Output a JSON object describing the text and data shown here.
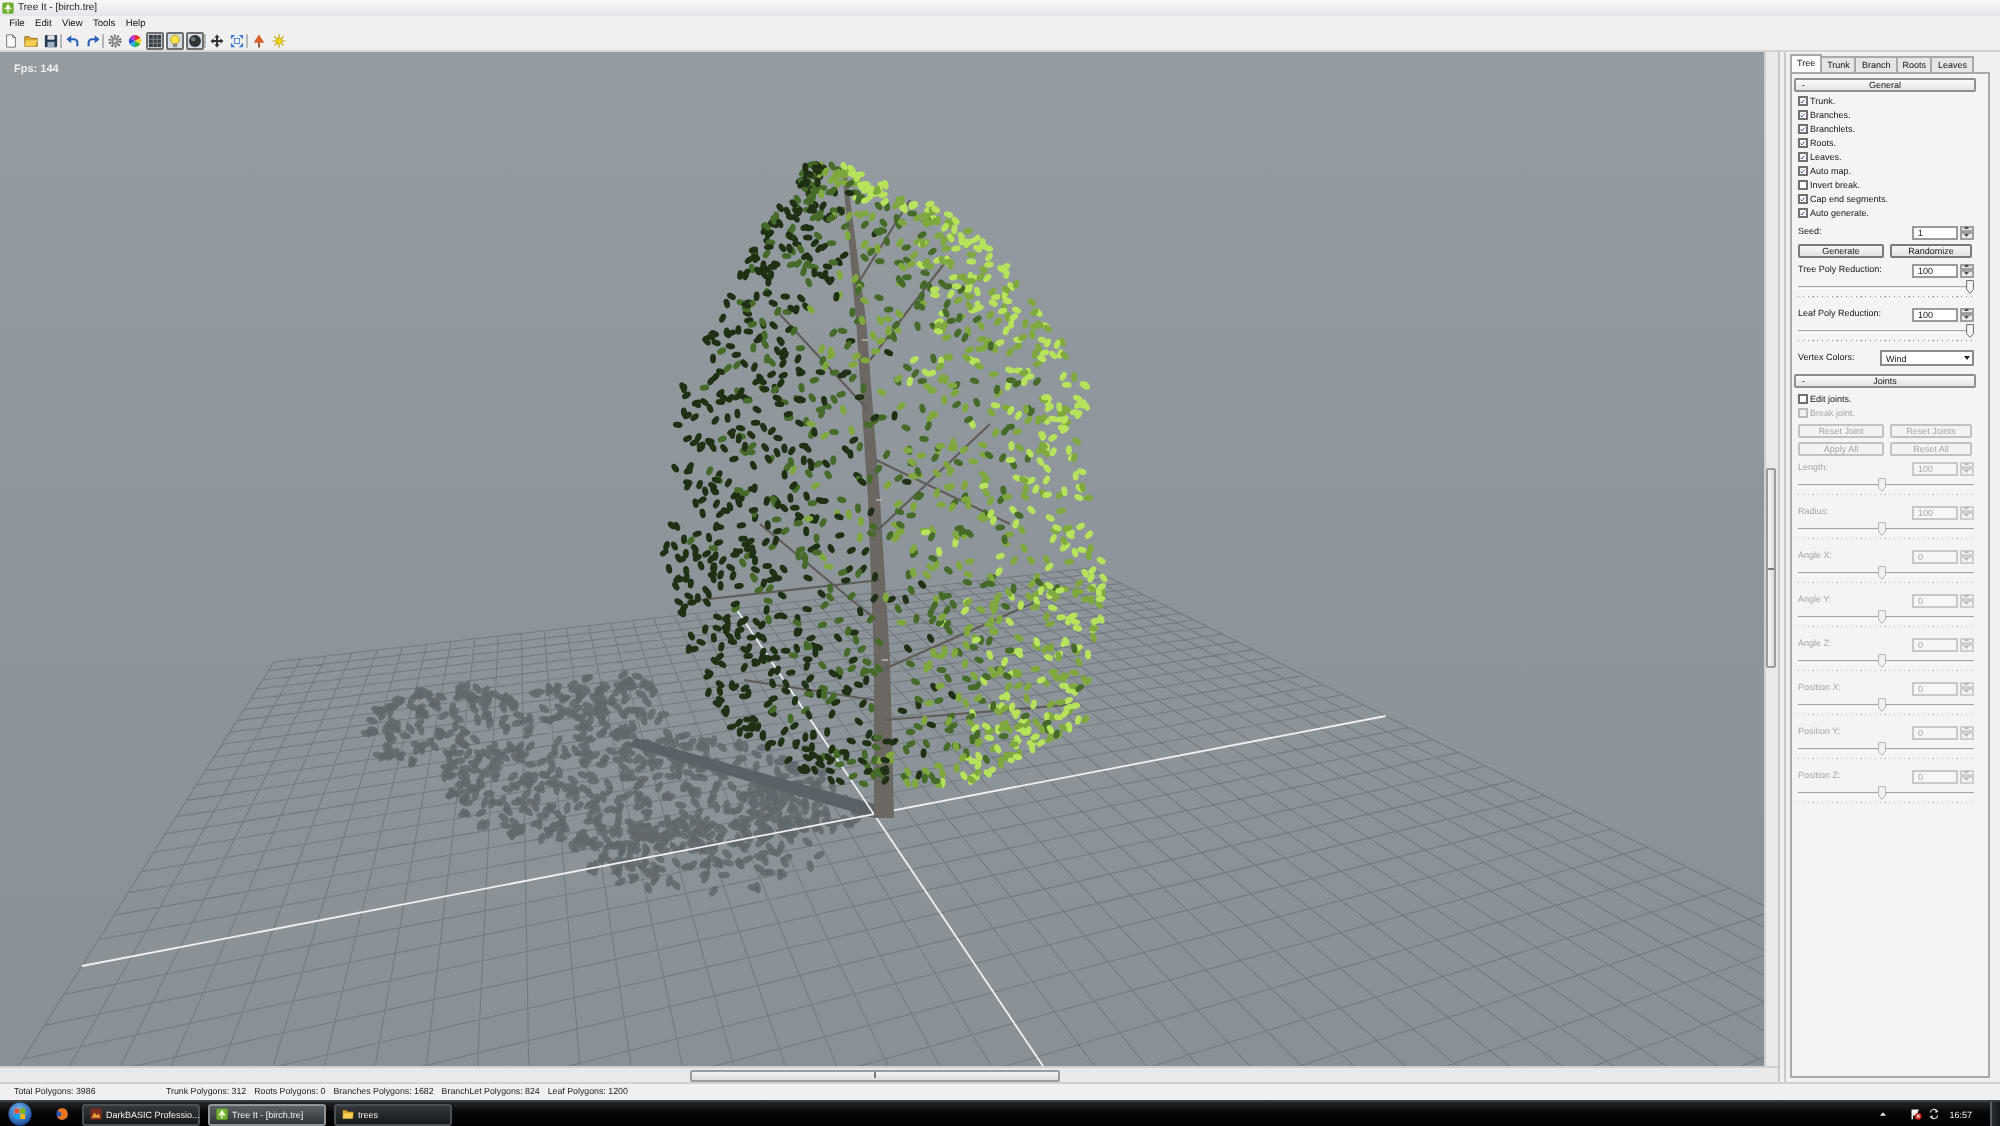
{
  "window": {
    "title": "Tree It - [birch.tre]"
  },
  "menu": [
    "File",
    "Edit",
    "View",
    "Tools",
    "Help"
  ],
  "toolbar": {
    "groups": [
      {
        "buttons": [
          {
            "pressed": false
          },
          {
            "pressed": false
          },
          {
            "pressed": false
          }
        ]
      },
      {
        "buttons": [
          {
            "pressed": false
          },
          {
            "pressed": false
          }
        ]
      },
      {
        "buttons": [
          {
            "pressed": false
          },
          {
            "pressed": false
          },
          {
            "pressed": true
          },
          {
            "pressed": true
          },
          {
            "pressed": true
          }
        ]
      },
      {
        "buttons": [
          {
            "pressed": false
          },
          {
            "pressed": false
          }
        ]
      },
      {
        "buttons": [
          {
            "pressed": false
          },
          {
            "pressed": false
          }
        ]
      }
    ]
  },
  "viewport": {
    "fps": "Fps: 144"
  },
  "panel": {
    "tabs": [
      {
        "label": "Tree",
        "selected": true
      },
      {
        "label": "Trunk",
        "selected": false
      },
      {
        "label": "Branch",
        "selected": false
      },
      {
        "label": "Roots",
        "selected": false
      },
      {
        "label": "Leaves",
        "selected": false
      }
    ],
    "sections": [
      {
        "toggle": "-",
        "title": "General",
        "expanded": true,
        "items": [
          {
            "kind": "checkbox",
            "label": "Trunk.",
            "checked": true,
            "disabled": false
          },
          {
            "kind": "checkbox",
            "label": "Branches.",
            "checked": true,
            "disabled": false
          },
          {
            "kind": "checkbox",
            "label": "Branchlets.",
            "checked": true,
            "disabled": false
          },
          {
            "kind": "checkbox",
            "label": "Roots.",
            "checked": true,
            "disabled": false
          },
          {
            "kind": "checkbox",
            "label": "Leaves.",
            "checked": true,
            "disabled": false
          },
          {
            "kind": "checkbox",
            "label": "Auto map.",
            "checked": true,
            "disabled": false
          },
          {
            "kind": "checkbox",
            "label": "Invert break.",
            "checked": false,
            "disabled": false
          },
          {
            "kind": "checkbox",
            "label": "Cap end segments.",
            "checked": true,
            "disabled": false
          },
          {
            "kind": "checkbox",
            "label": "Auto generate.",
            "checked": true,
            "disabled": false
          },
          {
            "kind": "spinner",
            "label": "Seed:",
            "value": "1",
            "disabled": false
          },
          {
            "kind": "buttons",
            "buttons": [
              {
                "label": "Generate",
                "disabled": false
              },
              {
                "label": "Randomize",
                "disabled": false
              }
            ]
          },
          {
            "kind": "slider",
            "label": "Tree Poly Reduction:",
            "value": "100",
            "level": 1,
            "disabled": false
          },
          {
            "kind": "slider",
            "label": "Leaf Poly Reduction:",
            "value": "100",
            "level": 1,
            "disabled": false
          },
          {
            "kind": "dropdown",
            "label": "Vertex Colors:",
            "value": "Wind",
            "disabled": false
          }
        ]
      },
      {
        "toggle": "-",
        "title": "Joints",
        "expanded": true,
        "items": [
          {
            "kind": "checkbox",
            "label": "Edit joints.",
            "checked": false,
            "disabled": false
          },
          {
            "kind": "checkbox",
            "label": "Break joint.",
            "checked": false,
            "disabled": true
          },
          {
            "kind": "buttons",
            "buttons": [
              {
                "label": "Reset Joint",
                "disabled": true
              },
              {
                "label": "Reset Joints",
                "disabled": true
              }
            ]
          },
          {
            "kind": "buttons",
            "buttons": [
              {
                "label": "Apply All",
                "disabled": true
              },
              {
                "label": "Reset All",
                "disabled": true
              }
            ]
          },
          {
            "kind": "slider",
            "label": "Length:",
            "value": "100",
            "level": 0.48,
            "disabled": true
          },
          {
            "kind": "slider",
            "label": "Radius:",
            "value": "100",
            "level": 0.48,
            "disabled": true
          },
          {
            "kind": "slider",
            "label": "Angle X:",
            "value": "0",
            "level": 0.48,
            "disabled": true
          },
          {
            "kind": "slider",
            "label": "Angle Y:",
            "value": "0",
            "level": 0.48,
            "disabled": true
          },
          {
            "kind": "slider",
            "label": "Angle Z:",
            "value": "0",
            "level": 0.48,
            "disabled": true
          },
          {
            "kind": "slider",
            "label": "Position X:",
            "value": "0",
            "level": 0.48,
            "disabled": true
          },
          {
            "kind": "slider",
            "label": "Position Y:",
            "value": "0",
            "level": 0.48,
            "disabled": true
          },
          {
            "kind": "slider",
            "label": "Position Z:",
            "value": "0",
            "level": 0.48,
            "disabled": true
          }
        ]
      }
    ]
  },
  "status_bar": {
    "fields": [
      "Total Polygons: 3986",
      "Trunk Polygons: 312",
      "Roots Polygons: 0",
      "Branches Polygons: 1682",
      "BranchLet Polygons: 824",
      "Leaf Polygons: 1200"
    ]
  },
  "taskbar": {
    "tasks": [
      {
        "label": "DarkBASIC Professio...",
        "selected": false
      },
      {
        "label": "Tree It - [birch.tre]",
        "selected": true
      },
      {
        "label": "trees",
        "selected": false
      }
    ],
    "clock": "16:57"
  }
}
